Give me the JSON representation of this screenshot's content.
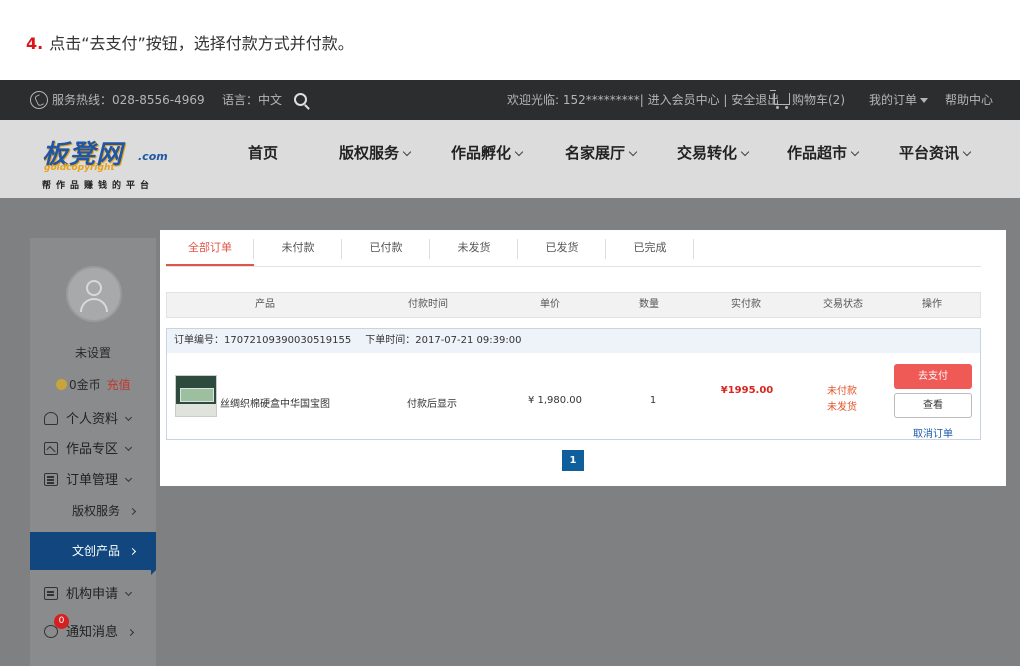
{
  "instruction": {
    "step": "4.",
    "text": "点击“去支付”按钮，选择付款方式并付款。"
  },
  "topbar": {
    "hotline": "服务热线：028-8556-4969",
    "language": "语言：中文",
    "welcome": "欢迎光临: 152*********| 进入会员中心 | 安全退出",
    "cart": "购物车(2)",
    "my_orders": "我的订单",
    "help": "帮助中心"
  },
  "logo": {
    "main": "板凳网",
    "suffix": ".com",
    "english": "goldcopyright",
    "slogan": "帮作品赚钱的平台"
  },
  "nav": {
    "items": [
      "首页",
      "版权服务",
      "作品孵化",
      "名家展厅",
      "交易转化",
      "作品超市",
      "平台资讯"
    ]
  },
  "sidebar": {
    "nickname": "未设置",
    "coins": "0金币",
    "recharge": "充值",
    "items": [
      "个人资料",
      "作品专区",
      "订单管理",
      "版权服务",
      "文创产品",
      "机构申请",
      "通知消息"
    ],
    "notification_count": "0"
  },
  "tabs": [
    "全部订单",
    "未付款",
    "已付款",
    "未发货",
    "已发货",
    "已完成"
  ],
  "table": {
    "headers": [
      "产品",
      "付款时间",
      "单价",
      "数量",
      "实付款",
      "交易状态",
      "操作"
    ]
  },
  "order": {
    "number": "订单编号：17072109390030519155",
    "time": "下单时间：2017-07-21 09:39:00",
    "product": "丝绸织棉硬盒中华国宝图",
    "pay_time": "付款后显示",
    "unit_price": "¥ 1,980.00",
    "quantity": "1",
    "paid": "¥1995.00",
    "status_pay": "未付款",
    "status_ship": "未发货",
    "btn_pay": "去支付",
    "btn_view": "查看",
    "cancel": "取消订单"
  },
  "pagination": {
    "current": "1"
  }
}
